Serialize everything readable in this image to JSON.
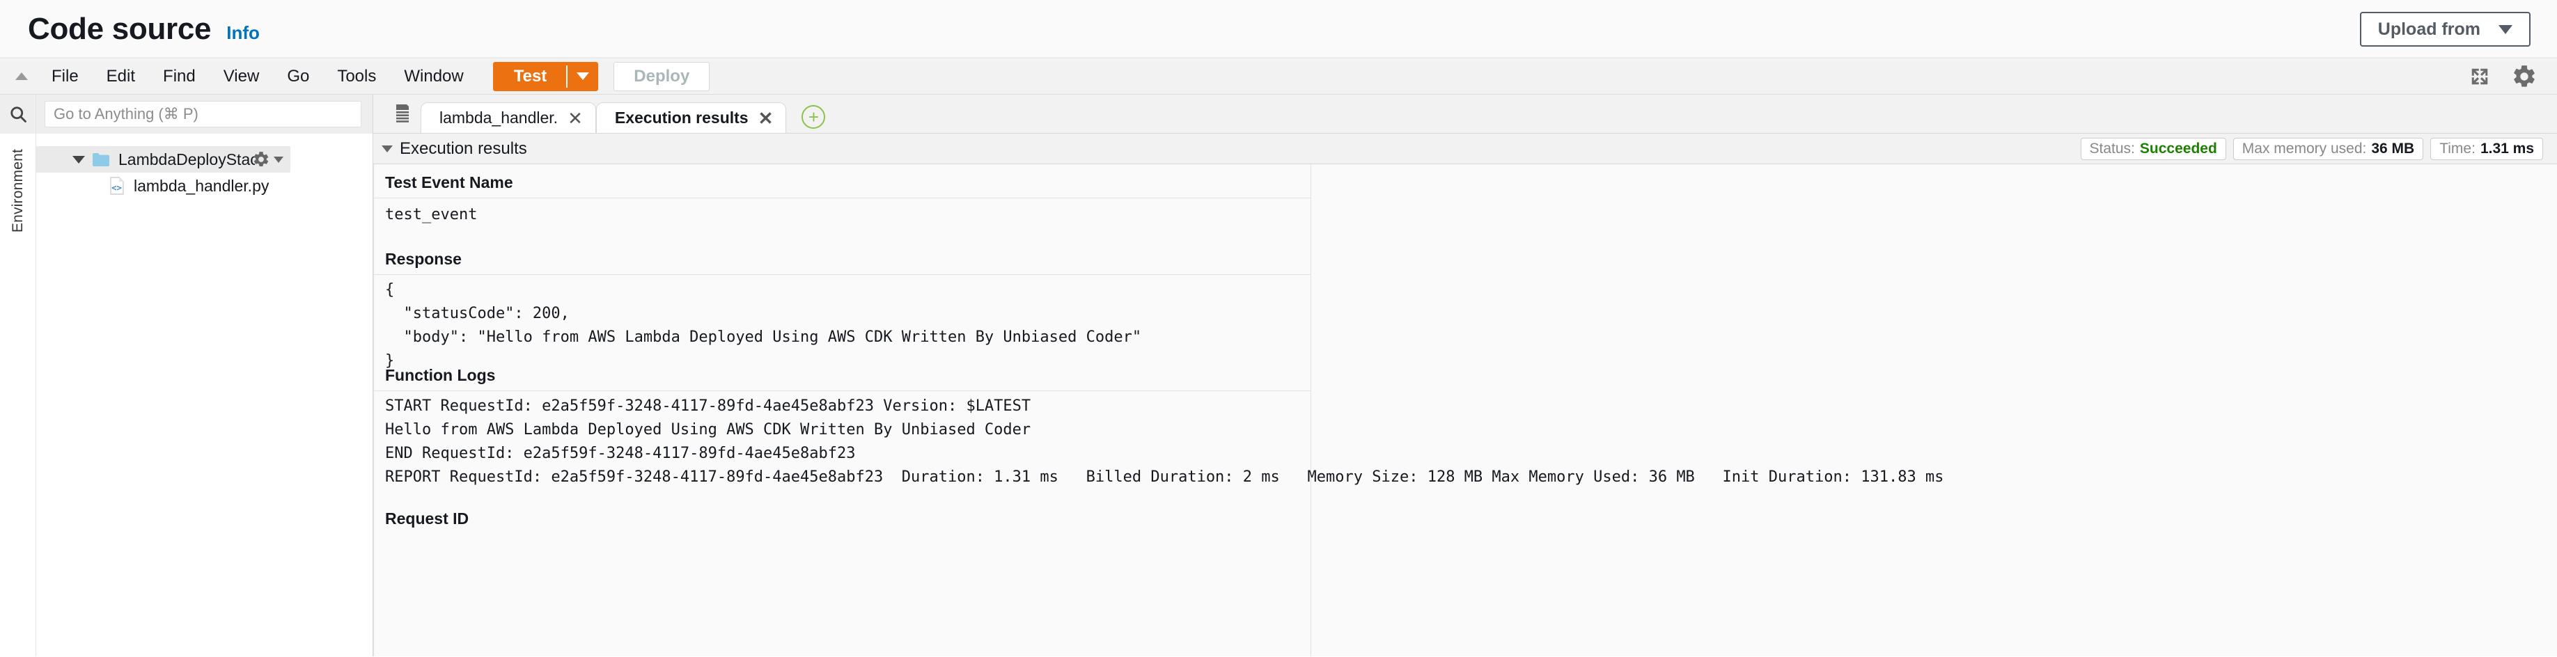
{
  "header": {
    "title": "Code source",
    "info_label": "Info",
    "upload_button": "Upload from"
  },
  "menu": {
    "collapse_icon": "triangle-up-icon",
    "items": [
      "File",
      "Edit",
      "Find",
      "View",
      "Go",
      "Tools",
      "Window"
    ],
    "test_label": "Test",
    "deploy_label": "Deploy",
    "expand_icon": "expand-icon",
    "settings_icon": "gear-icon"
  },
  "sidebar": {
    "rail_label": "Environment",
    "search_icon": "search-icon",
    "goto_placeholder": "Go to Anything (⌘ P)",
    "goto_value": "",
    "tree": {
      "folder": "LambdaDeployStac",
      "file": "lambda_handler.py"
    }
  },
  "tabs": {
    "list_icon": "tab-list-icon",
    "items": [
      {
        "label": "lambda_handler.",
        "active": false
      },
      {
        "label": "Execution results",
        "active": true
      }
    ],
    "add_label": "+"
  },
  "execution": {
    "panel_title": "Execution results",
    "badges": [
      {
        "label": "Status:",
        "value": "Succeeded",
        "ok": true
      },
      {
        "label": "Max memory used:",
        "value": "36 MB",
        "ok": false
      },
      {
        "label": "Time:",
        "value": "1.31 ms",
        "ok": false
      }
    ],
    "sections": {
      "test_event_name": {
        "title": "Test Event Name",
        "body": "test_event"
      },
      "response": {
        "title": "Response",
        "body": "{\n  \"statusCode\": 200,\n  \"body\": \"Hello from AWS Lambda Deployed Using AWS CDK Written By Unbiased Coder\"\n}"
      },
      "function_logs": {
        "title": "Function Logs",
        "body": "START RequestId: e2a5f59f-3248-4117-89fd-4ae45e8abf23 Version: $LATEST\nHello from AWS Lambda Deployed Using AWS CDK Written By Unbiased Coder\nEND RequestId: e2a5f59f-3248-4117-89fd-4ae45e8abf23\nREPORT RequestId: e2a5f59f-3248-4117-89fd-4ae45e8abf23  Duration: 1.31 ms   Billed Duration: 2 ms   Memory Size: 128 MB Max Memory Used: 36 MB   Init Duration: 131.83 ms"
      },
      "request_id": {
        "title": "Request ID"
      }
    }
  }
}
